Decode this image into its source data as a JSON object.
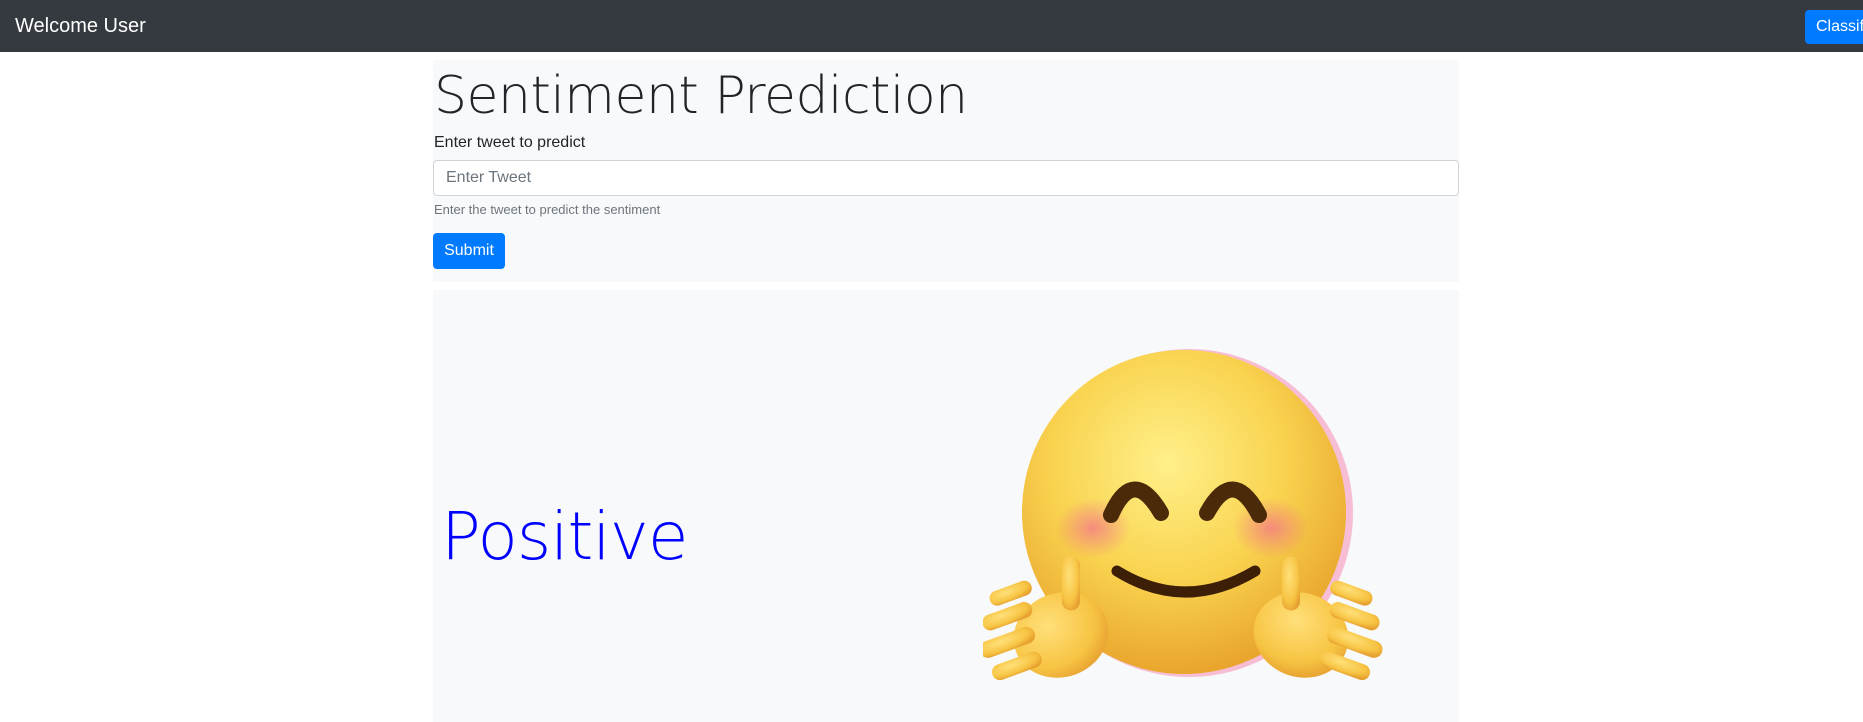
{
  "navbar": {
    "brand": "Welcome User",
    "classify_label": "Classify"
  },
  "form": {
    "title": "Sentiment Prediction",
    "label": "Enter tweet to predict",
    "input_placeholder": "Enter Tweet",
    "input_value": "",
    "help_text": "Enter the tweet to predict the sentiment",
    "submit_label": "Submit"
  },
  "result": {
    "sentiment": "Positive",
    "sentiment_color": "#0000ff",
    "emoji_icon": "smiling-face-with-open-hands-icon"
  },
  "colors": {
    "navbar_bg": "#343a40",
    "primary": "#007bff",
    "card_bg": "#f8f9fa"
  }
}
